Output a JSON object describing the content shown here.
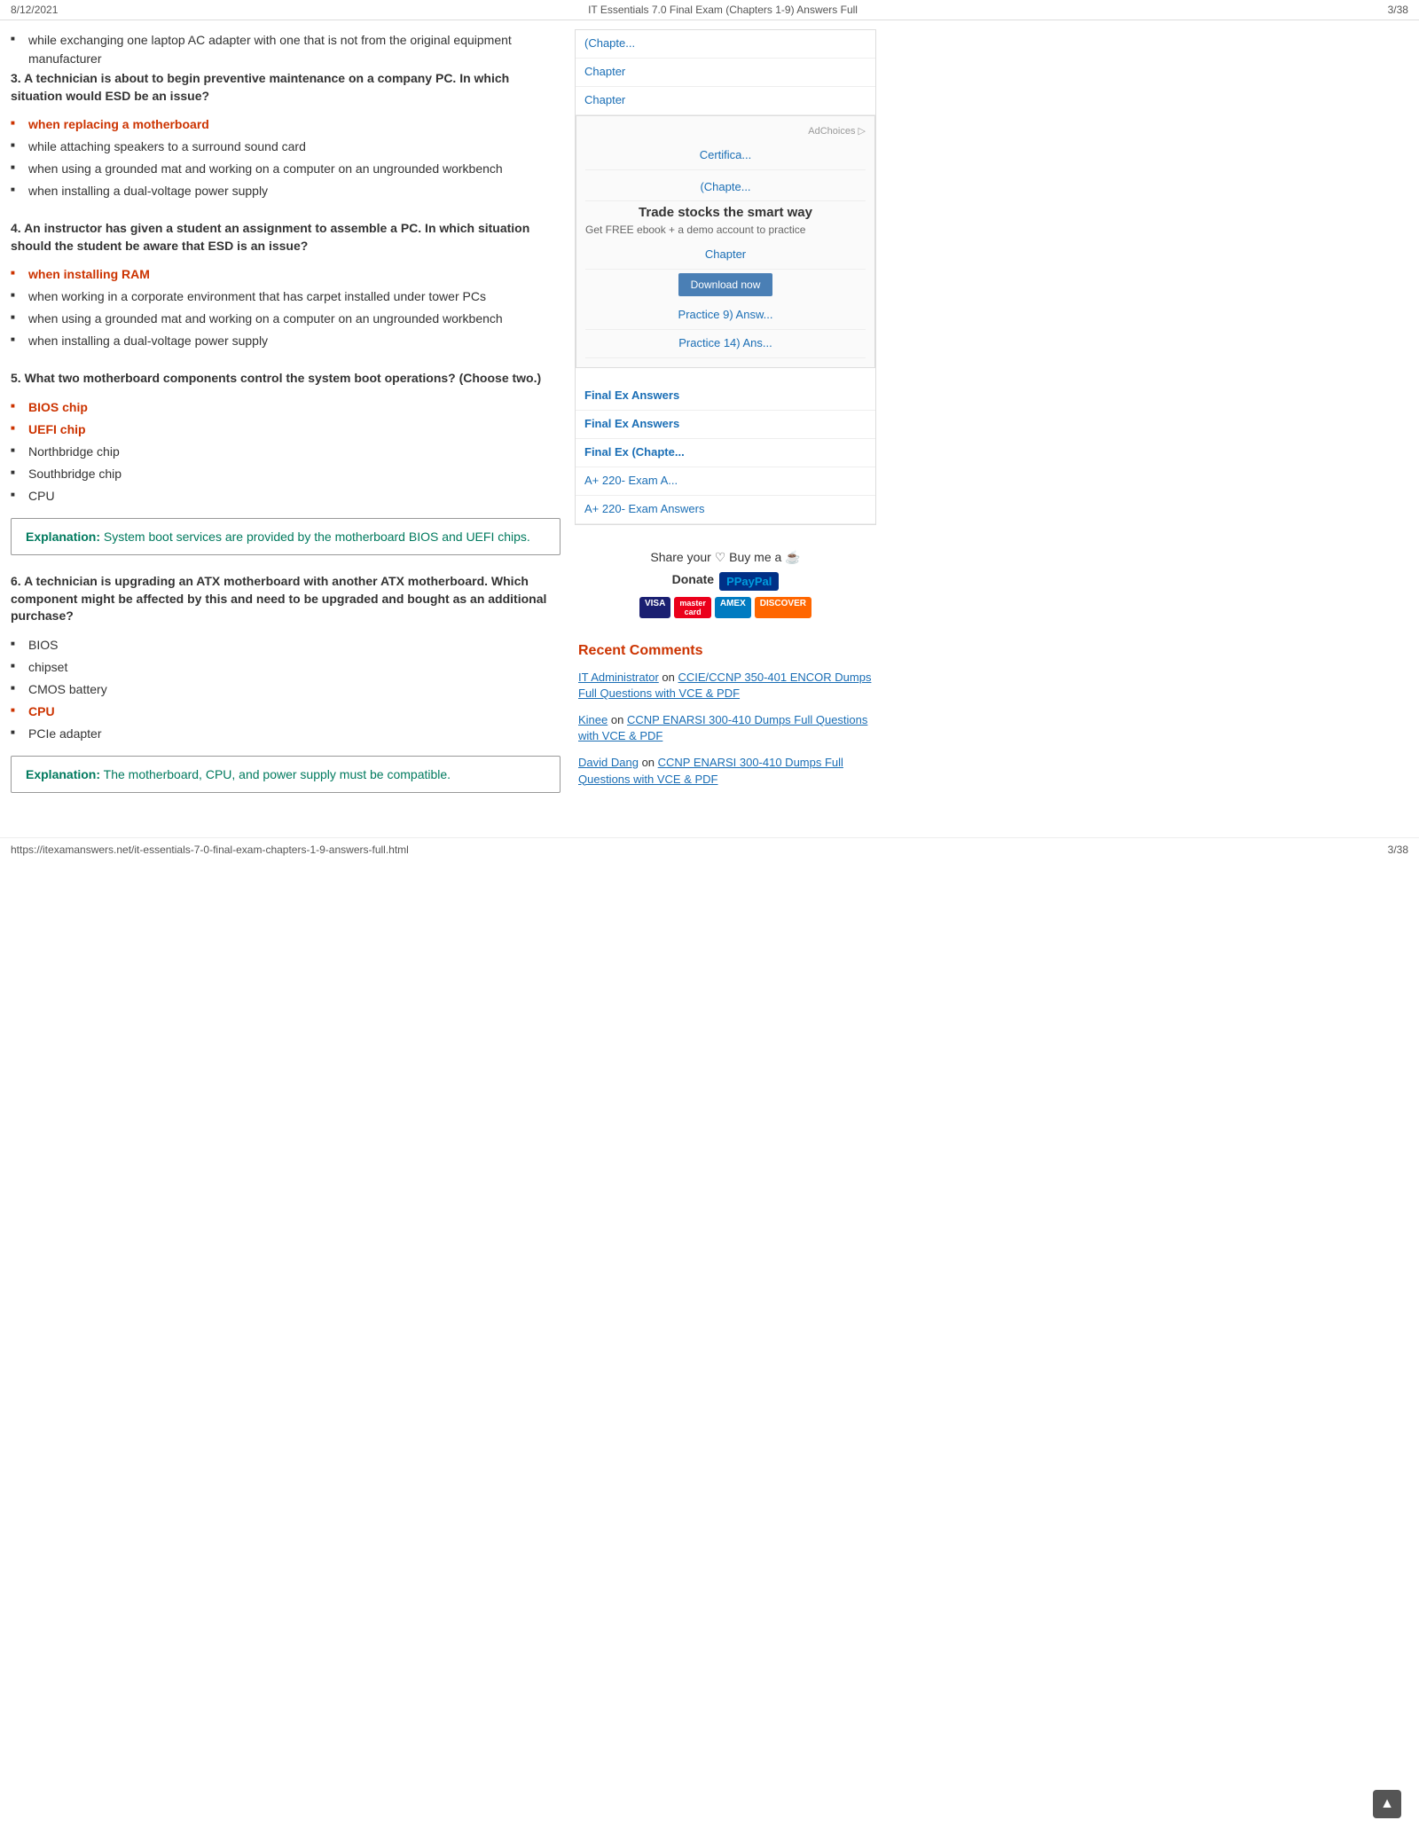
{
  "topbar": {
    "date": "8/12/2021",
    "title": "IT Essentials 7.0 Final Exam (Chapters 1-9) Answers Full",
    "page": "3/38"
  },
  "main": {
    "intro_bullet": "while exchanging one laptop AC adapter with one that is not from the original equipment manufacturer",
    "questions": [
      {
        "number": "3.",
        "text": "A technician is about to begin preventive maintenance on a company PC. In which situation would ESD be an issue?",
        "answers": [
          {
            "text": "when replacing a motherboard",
            "correct": true
          },
          {
            "text": "while attaching speakers to a surround sound card",
            "correct": false
          },
          {
            "text": "when using a grounded mat and working on a computer on an ungrounded workbench",
            "correct": false
          },
          {
            "text": "when installing a dual-voltage power supply",
            "correct": false
          }
        ]
      },
      {
        "number": "4.",
        "text": "An instructor has given a student an assignment to assemble a PC. In which situation should the student be aware that ESD is an issue?",
        "answers": [
          {
            "text": "when installing RAM",
            "correct": true
          },
          {
            "text": "when working in a corporate environment that has carpet installed under tower PCs",
            "correct": false
          },
          {
            "text": "when using a grounded mat and working on a computer on an ungrounded workbench",
            "correct": false
          },
          {
            "text": "when installing a dual-voltage power supply",
            "correct": false
          }
        ]
      },
      {
        "number": "5.",
        "text": "What two motherboard components control the system boot operations? (Choose two.)",
        "answers": [
          {
            "text": "BIOS chip",
            "correct": true
          },
          {
            "text": "UEFI chip",
            "correct": true
          },
          {
            "text": "Northbridge chip",
            "correct": false
          },
          {
            "text": "Southbridge chip",
            "correct": false
          },
          {
            "text": "CPU",
            "correct": false
          }
        ],
        "explanation": {
          "label": "Explanation:",
          "text": " System boot services are provided by the motherboard BIOS and UEFI chips."
        }
      },
      {
        "number": "6.",
        "text": "A technician is upgrading an ATX motherboard with another ATX motherboard. Which component might be affected by this and need to be upgraded and bought as an additional purchase?",
        "answers": [
          {
            "text": "BIOS",
            "correct": false
          },
          {
            "text": "chipset",
            "correct": false
          },
          {
            "text": "CMOS battery",
            "correct": false
          },
          {
            "text": "CPU",
            "correct": true
          },
          {
            "text": "PCIe adapter",
            "correct": false
          }
        ],
        "explanation": {
          "label": "Explanation:",
          "text": " The motherboard, CPU, and power supply must be compatible."
        }
      }
    ]
  },
  "sidebar": {
    "nav_items": [
      {
        "text": "(Chapte..."
      },
      {
        "text": "Chapter"
      },
      {
        "text": "Chapter"
      },
      {
        "text": "Certifica..."
      },
      {
        "text": "(Chapte..."
      },
      {
        "text": "Chapter"
      },
      {
        "text": "Practice 9) Answ..."
      },
      {
        "text": "Practice 14) Ans..."
      },
      {
        "text": "Final Ex Answers"
      },
      {
        "text": "Final Ex Answers"
      },
      {
        "text": "Final Ex (Chapte..."
      },
      {
        "text": "A+ 220- Exam A..."
      },
      {
        "text": "A+ 220- Exam Answers"
      }
    ],
    "ad": {
      "label": "AdChoices",
      "title": "Trade stocks the smart way",
      "subtitle": "",
      "body": "Get FREE ebook + a demo account to practice",
      "download_btn": "Download now"
    },
    "donate": {
      "share_text": "Share your ♡ Buy me a ☕",
      "donate_label": "Donate",
      "paypal_text": "PayPal",
      "cards": [
        "VISA",
        "MC",
        "AMEX",
        "DISCOVER"
      ]
    },
    "recent_comments": {
      "heading": "Recent Comments",
      "items": [
        {
          "commenter": "IT Administrator",
          "on_text": " on ",
          "link_text": "CCIE/CCNP 350-401 ENCOR Dumps Full Questions with VCE & PDF"
        },
        {
          "commenter": "Kinee",
          "on_text": " on ",
          "link_text": "CCNP ENARSI 300-410 Dumps Full Questions with VCE & PDF"
        },
        {
          "commenter": "David Dang",
          "on_text": " on ",
          "link_text": "CCNP ENARSI 300-410 Dumps Full Questions with VCE & PDF"
        }
      ]
    }
  },
  "bottombar": {
    "url": "https://itexamanswers.net/it-essentials-7-0-final-exam-chapters-1-9-answers-full.html",
    "page": "3/38"
  }
}
